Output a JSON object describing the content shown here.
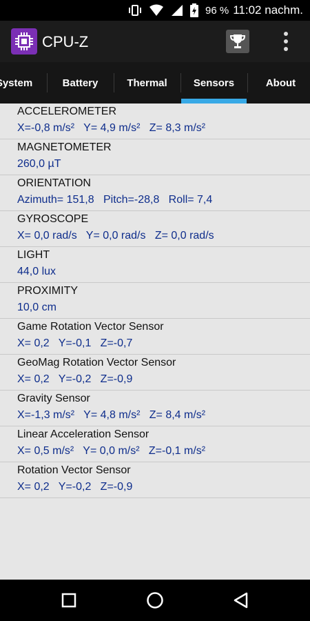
{
  "status_bar": {
    "battery_percent": "96 %",
    "time": "11:02 nachm."
  },
  "app": {
    "title": "CPU-Z"
  },
  "tabs": [
    {
      "label": "System"
    },
    {
      "label": "Battery"
    },
    {
      "label": "Thermal"
    },
    {
      "label": "Sensors",
      "active": true
    },
    {
      "label": "About"
    }
  ],
  "sensors": [
    {
      "name": "ACCELEROMETER",
      "value": "X=-0,8 m/s²   Y= 4,9 m/s²   Z= 8,3 m/s²"
    },
    {
      "name": "MAGNETOMETER",
      "value": "260,0 µT"
    },
    {
      "name": "ORIENTATION",
      "value": "Azimuth= 151,8   Pitch=-28,8   Roll= 7,4"
    },
    {
      "name": "GYROSCOPE",
      "value": "X= 0,0 rad/s   Y= 0,0 rad/s   Z= 0,0 rad/s"
    },
    {
      "name": "LIGHT",
      "value": "44,0 lux"
    },
    {
      "name": "PROXIMITY",
      "value": "10,0 cm"
    },
    {
      "name": "Game Rotation Vector Sensor",
      "value": "X= 0,2   Y=-0,1   Z=-0,7"
    },
    {
      "name": "GeoMag Rotation Vector Sensor",
      "value": "X= 0,2   Y=-0,2   Z=-0,9"
    },
    {
      "name": "Gravity Sensor",
      "value": "X=-1,3 m/s²   Y= 4,8 m/s²   Z= 8,4 m/s²"
    },
    {
      "name": "Linear Acceleration Sensor",
      "value": "X= 0,5 m/s²   Y= 0,0 m/s²   Z=-0,1 m/s²"
    },
    {
      "name": "Rotation Vector Sensor",
      "value": "X= 0,2   Y=-0,2   Z=-0,9"
    }
  ],
  "icons": {
    "vibrate": "vibrate-icon",
    "wifi": "wifi-icon",
    "signal": "signal-icon",
    "battery": "battery-charging-icon",
    "logo": "cpu-chip-icon",
    "trophy": "trophy-icon",
    "menu": "more-vert-icon",
    "nav_recent": "square-icon",
    "nav_home": "circle-icon",
    "nav_back": "triangle-back-icon"
  },
  "colors": {
    "accent": "#38a9e6",
    "value_text": "#0e2d8c",
    "logo_bg": "#7b2fb5"
  }
}
